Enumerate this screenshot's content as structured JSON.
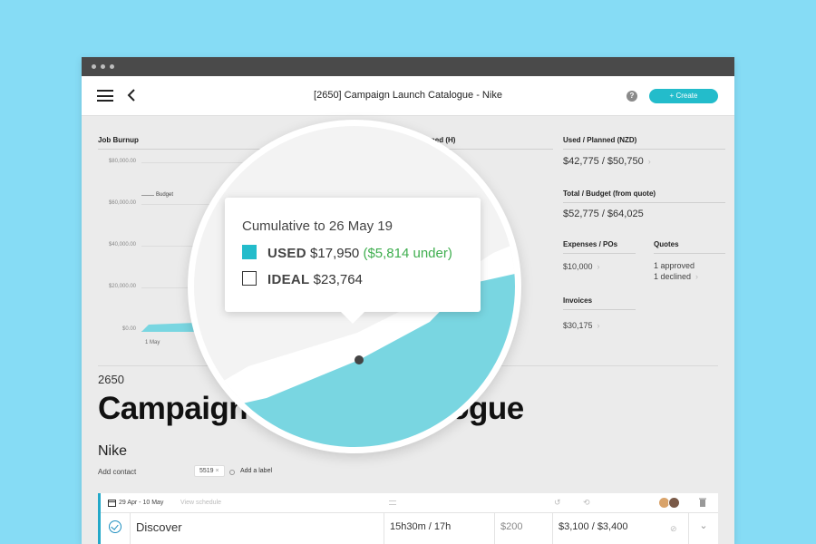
{
  "app": {
    "title": "[2650] Campaign Launch Catalogue - Nike",
    "create_label": "+ Create",
    "help_label": "?"
  },
  "burnup": {
    "label": "Job Burnup",
    "planned_label_partial": "nned (H)",
    "budget_marker": "Budget",
    "y_ticks": [
      "$80,000.00",
      "$60,000.00",
      "$40,000.00",
      "$20,000.00",
      "$0.00"
    ],
    "x_start": "1 May"
  },
  "stats": {
    "used_planned_label": "Used / Planned (NZD)",
    "used_planned_value": "$42,775 / $50,750",
    "total_budget_label": "Total / Budget (from quote)",
    "total_budget_value": "$52,775 / $64,025",
    "expenses_label": "Expenses / POs",
    "expenses_value": "$10,000",
    "quotes_label": "Quotes",
    "quotes_approved": "1 approved",
    "quotes_declined": "1 declined",
    "invoices_label": "Invoices",
    "invoices_value": "$30,175"
  },
  "tooltip": {
    "title": "Cumulative to 26 May 19",
    "used_label": "USED",
    "used_value": "$17,950",
    "used_under": "($5,814 under)",
    "ideal_label": "IDEAL",
    "ideal_value": "$23,764"
  },
  "job": {
    "number": "2650",
    "title": "Campaign Launch Catalogue",
    "client": "Nike",
    "add_contact": "Add contact",
    "tag": "5519",
    "add_label": "Add a label"
  },
  "schedule": {
    "dates": "29 Apr  -  10 May",
    "view_schedule": "View schedule",
    "row": {
      "name": "Discover",
      "hours": "15h30m / 17h",
      "cost": "$200",
      "amount": "$3,100 / $3,400"
    }
  },
  "colors": {
    "accent": "#23bccb",
    "used_fill": "#79d6e1",
    "under_green": "#3fae4f",
    "sky_background": "#86dcf5"
  }
}
